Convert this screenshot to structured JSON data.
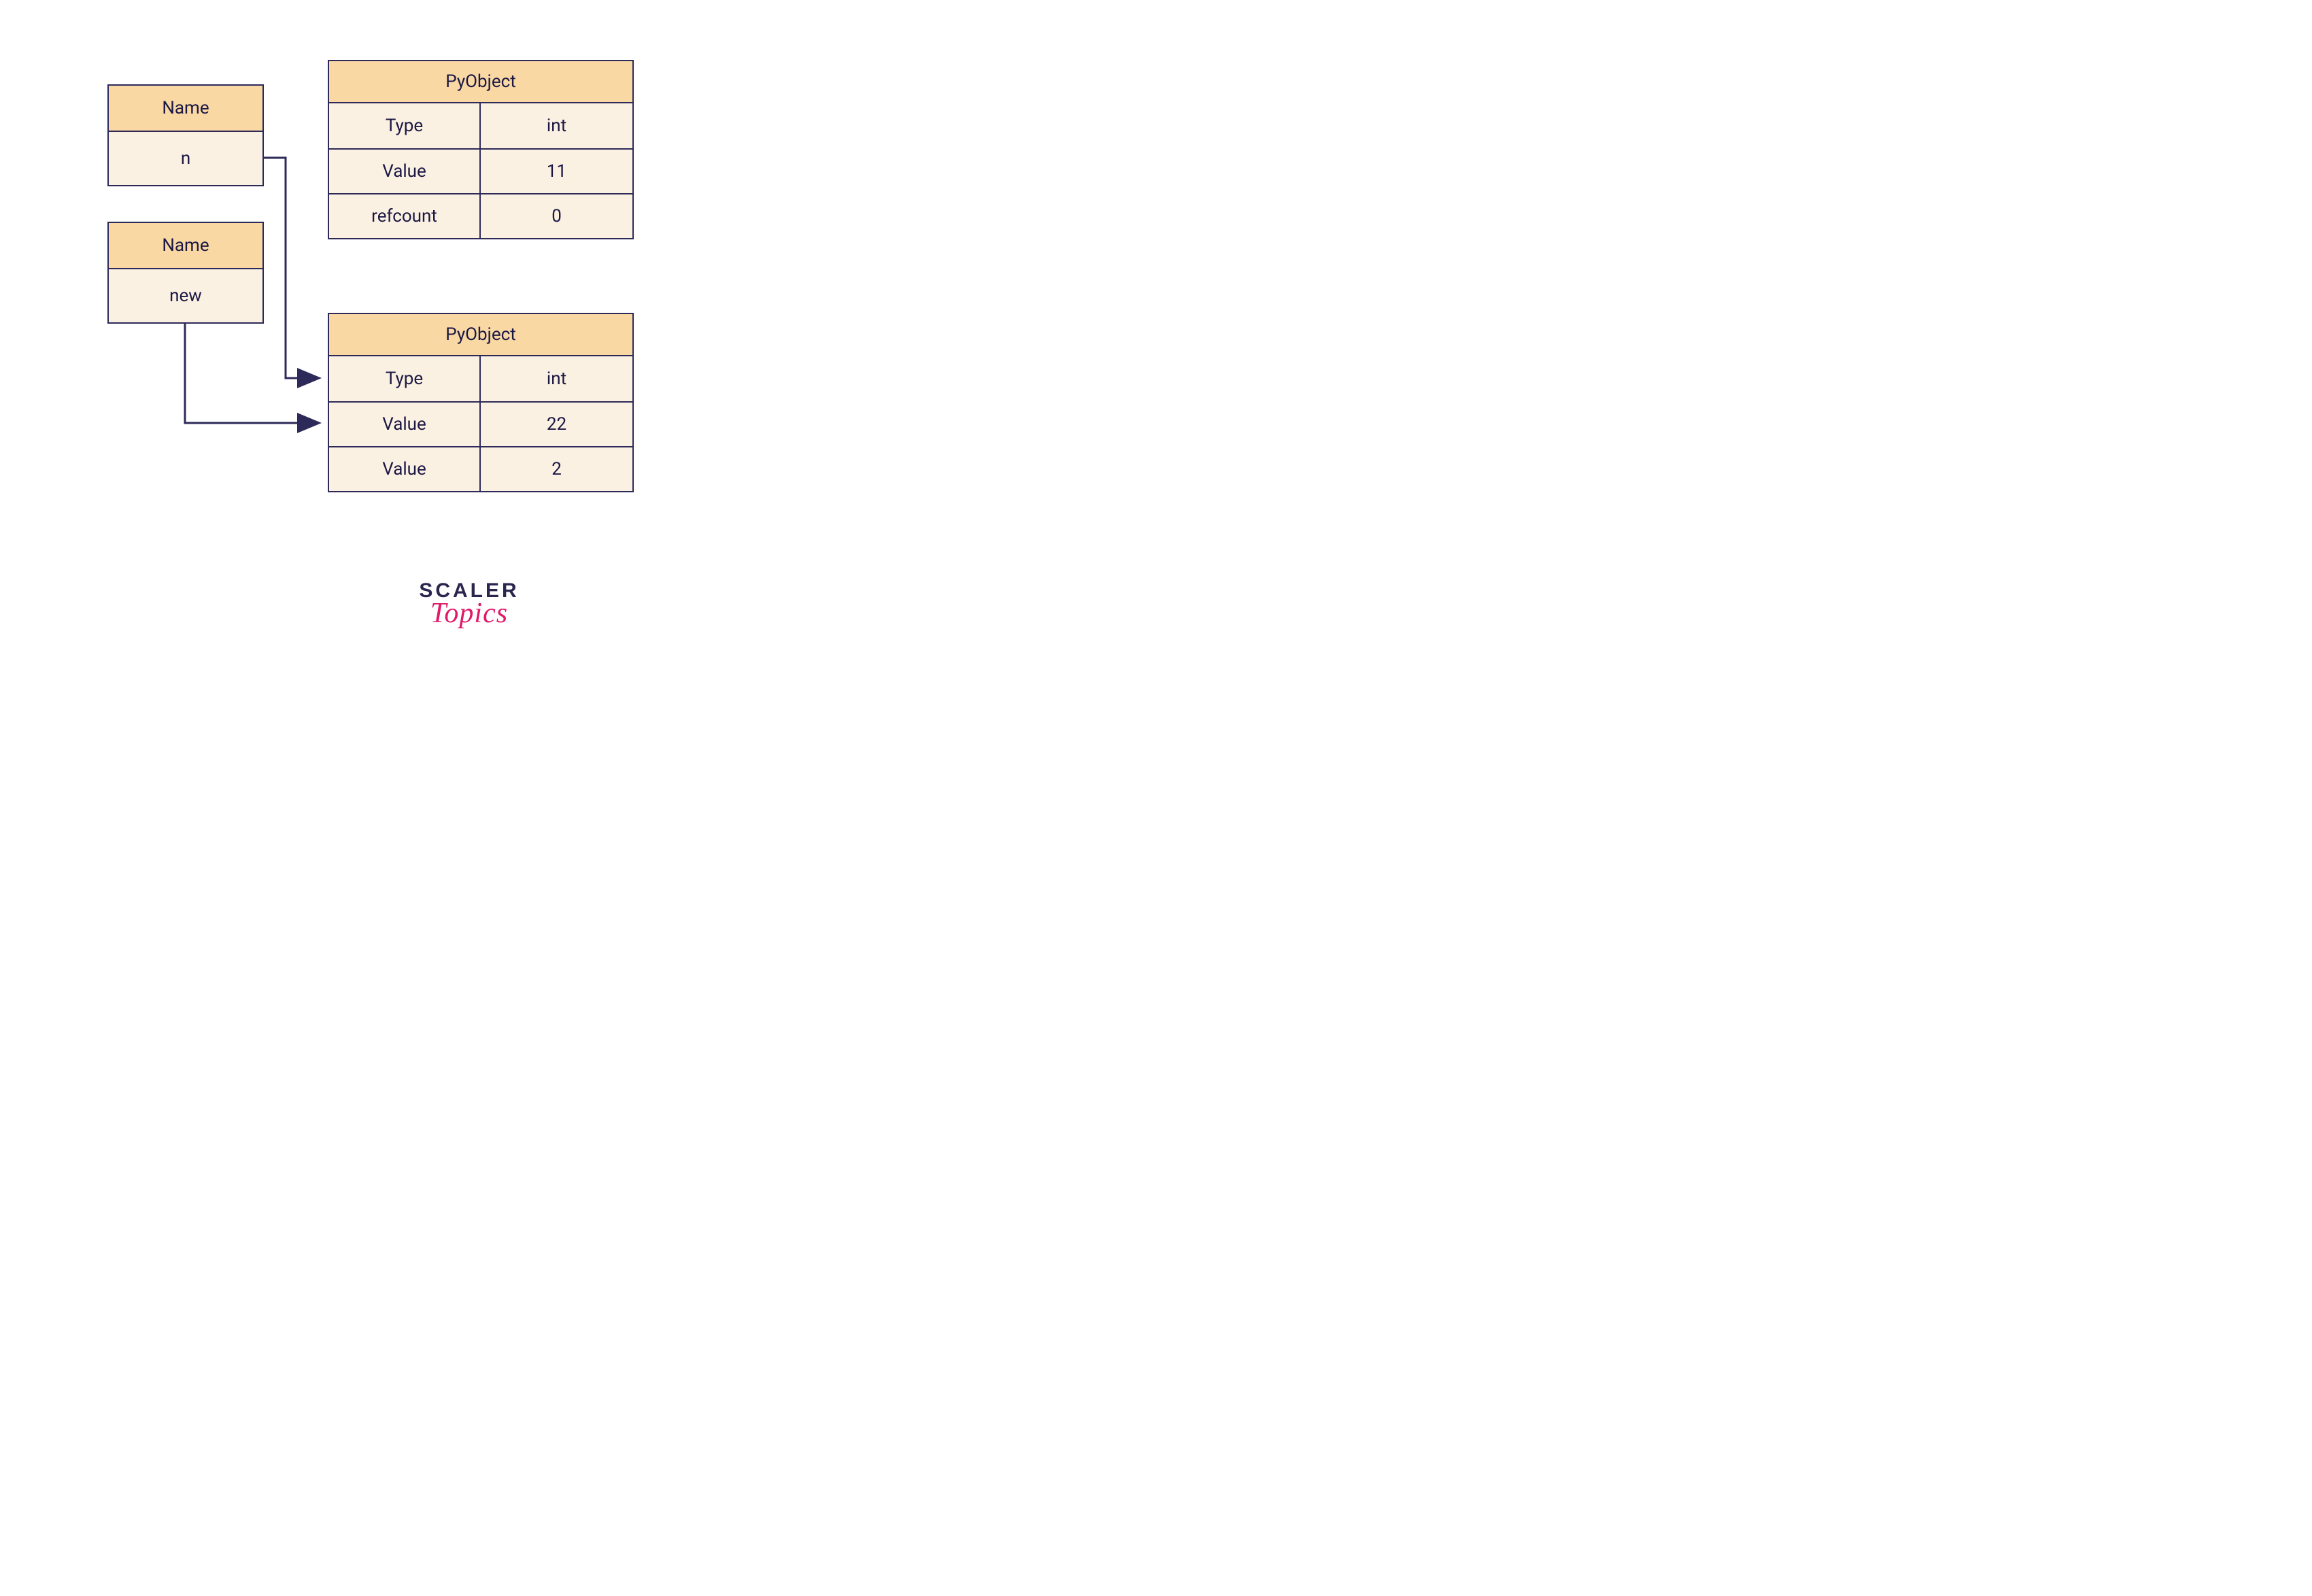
{
  "colors": {
    "border": "#2d2a5a",
    "header_bg": "#f9d8a3",
    "row_bg": "#fbf1e2",
    "text": "#1b1844",
    "logo_primary": "#2a264e",
    "logo_accent": "#e0196a"
  },
  "name_boxes": [
    {
      "header": "Name",
      "value": "n"
    },
    {
      "header": "Name",
      "value": "new"
    }
  ],
  "pyobjects": [
    {
      "header": "PyObject",
      "rows": [
        {
          "key": "Type",
          "val": "int"
        },
        {
          "key": "Value",
          "val": "11"
        },
        {
          "key": "refcount",
          "val": "0"
        }
      ]
    },
    {
      "header": "PyObject",
      "rows": [
        {
          "key": "Type",
          "val": "int"
        },
        {
          "key": "Value",
          "val": "22"
        },
        {
          "key": "Value",
          "val": "2"
        }
      ]
    }
  ],
  "logo": {
    "line1": "SCALER",
    "line2": "Topics"
  }
}
